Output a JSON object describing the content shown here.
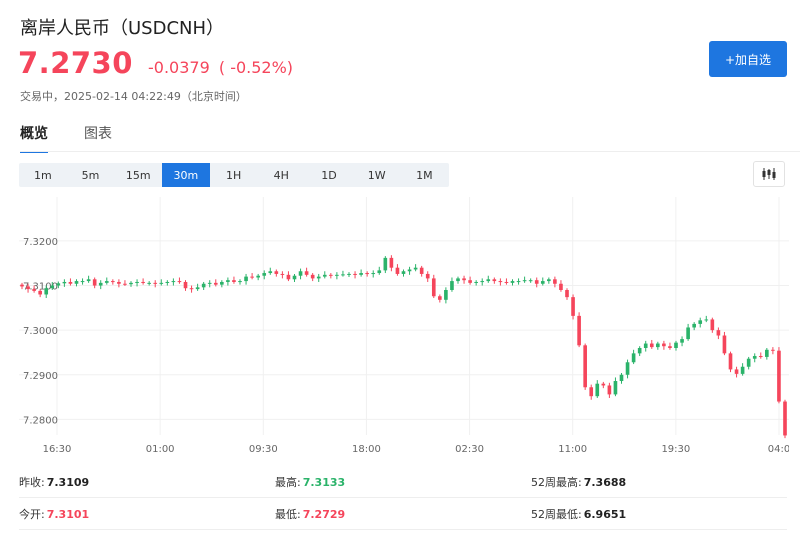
{
  "header": {
    "title": "离岸人民币（USDCNH）",
    "price": "7.2730",
    "change": "-0.0379",
    "change_pct": "( -0.52%)",
    "status": "交易中，2025-02-14 04:22:49（北京时间）",
    "add_watchlist_label": "+加自选"
  },
  "tabs": [
    {
      "label": "概览",
      "active": true
    },
    {
      "label": "图表",
      "active": false
    }
  ],
  "intervals": [
    "1m",
    "5m",
    "15m",
    "30m",
    "1H",
    "4H",
    "1D",
    "1W",
    "1M"
  ],
  "active_interval": "30m",
  "chart_type_icon": "candlestick-chart-icon",
  "colors": {
    "up": "#2bb36a",
    "down": "#f5455b",
    "accent": "#1e76e0"
  },
  "chart_data": {
    "type": "candlestick",
    "y_ticks": [
      "7.3200",
      "7.3100",
      "7.3000",
      "7.2900",
      "7.2800"
    ],
    "y_tick_values": [
      7.32,
      7.31,
      7.3,
      7.29,
      7.28
    ],
    "x_tick_labels": [
      "16:30",
      "01:00",
      "09:30",
      "18:00",
      "02:30",
      "11:00",
      "19:30",
      "04:0"
    ],
    "ylim": [
      7.2765,
      7.3285
    ],
    "grid": true,
    "closes": [
      7.3098,
      7.3092,
      7.3088,
      7.308,
      7.3094,
      7.31,
      7.3105,
      7.3108,
      7.3104,
      7.311,
      7.311,
      7.3114,
      7.31,
      7.3106,
      7.311,
      7.3108,
      7.3104,
      7.3103,
      7.3106,
      7.3108,
      7.3106,
      7.3106,
      7.3104,
      7.3106,
      7.3108,
      7.311,
      7.3108,
      7.3094,
      7.3092,
      7.3096,
      7.3104,
      7.3106,
      7.3102,
      7.3108,
      7.3112,
      7.3108,
      7.311,
      7.312,
      7.3118,
      7.3122,
      7.3128,
      7.3132,
      7.3126,
      7.3124,
      7.3114,
      7.3122,
      7.3132,
      7.3124,
      7.3116,
      7.312,
      7.3124,
      7.3122,
      7.3124,
      7.3125,
      7.3126,
      7.3124,
      7.3128,
      7.3126,
      7.3128,
      7.3134,
      7.3162,
      7.314,
      7.3126,
      7.3132,
      7.3136,
      7.314,
      7.3126,
      7.3116,
      7.3076,
      7.3068,
      7.309,
      7.311,
      7.3116,
      7.3112,
      7.3106,
      7.3108,
      7.311,
      7.3114,
      7.311,
      7.3108,
      7.3106,
      7.311,
      7.311,
      7.3112,
      7.3112,
      7.3104,
      7.311,
      7.3114,
      7.3104,
      7.309,
      7.3074,
      7.3032,
      7.2966,
      7.2872,
      7.2852,
      7.288,
      7.2876,
      7.2856,
      7.2886,
      7.29,
      7.2928,
      7.2948,
      7.296,
      7.297,
      7.2962,
      7.297,
      7.2964,
      7.296,
      7.2972,
      7.298,
      7.3006,
      7.3014,
      7.3022,
      7.3024,
      7.3,
      7.2988,
      7.2948,
      7.2912,
      7.2902,
      7.2918,
      7.2936,
      7.2942,
      7.294,
      7.2956,
      7.2954,
      7.284,
      7.2764
    ],
    "stats": {
      "prev_close": "7.3109",
      "high": "7.3133",
      "week52_high": "7.3688",
      "open": "7.3101",
      "low": "7.2729",
      "week52_low": "6.9651"
    }
  },
  "stats_labels": {
    "prev_close": "昨收:",
    "high": "最高:",
    "week52_high": "52周最高:",
    "open": "今开:",
    "low": "最低:",
    "week52_low": "52周最低:"
  }
}
